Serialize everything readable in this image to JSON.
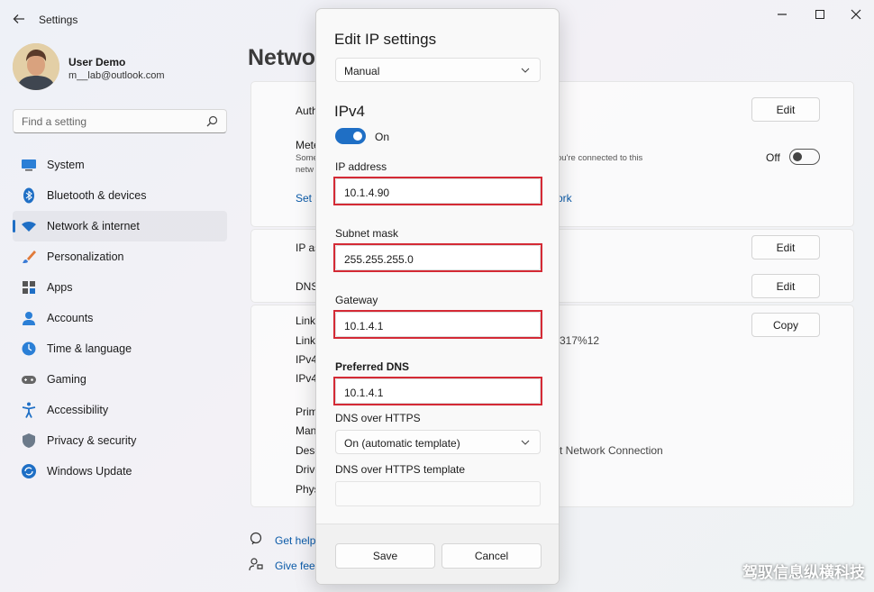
{
  "window": {
    "title": "Settings"
  },
  "user": {
    "name": "User Demo",
    "email": "m__lab@outlook.com"
  },
  "search": {
    "placeholder": "Find a setting"
  },
  "sidebar": {
    "items": [
      {
        "label": "System",
        "icon": "system-icon"
      },
      {
        "label": "Bluetooth & devices",
        "icon": "bluetooth-icon"
      },
      {
        "label": "Network & internet",
        "icon": "wifi-icon",
        "active": true
      },
      {
        "label": "Personalization",
        "icon": "brush-icon"
      },
      {
        "label": "Apps",
        "icon": "apps-icon"
      },
      {
        "label": "Accounts",
        "icon": "accounts-icon"
      },
      {
        "label": "Time & language",
        "icon": "clock-globe-icon"
      },
      {
        "label": "Gaming",
        "icon": "gamepad-icon"
      },
      {
        "label": "Accessibility",
        "icon": "accessibility-icon"
      },
      {
        "label": "Privacy & security",
        "icon": "shield-icon"
      },
      {
        "label": "Windows Update",
        "icon": "update-icon"
      }
    ]
  },
  "background": {
    "heading": "Networ",
    "rows": {
      "auth": "Auth",
      "metered": "Mete",
      "metered_desc_l": "Some",
      "metered_desc_r": "ou're connected to this",
      "metered_desc_2": "netw",
      "set_link_l": "Set a",
      "set_link_r": "ork",
      "ip_assign": "IP as",
      "dns": "DNS",
      "link1": "Link",
      "link2": "Link-",
      "link2_val": "317%12",
      "ipv4a": "IPv4",
      "ipv4b": "IPv4",
      "primary": "Prim",
      "manufacturer": "Man",
      "description": "Desc",
      "description_val": "t Network Connection",
      "driver": "Drive",
      "physical": "Phys"
    },
    "buttons": {
      "edit1": "Edit",
      "edit2": "Edit",
      "edit3": "Edit",
      "copy": "Copy"
    },
    "metered_toggle": "Off",
    "links": {
      "get_help": "Get help",
      "give_feedback": "Give feec"
    }
  },
  "dialog": {
    "title": "Edit IP settings",
    "mode": "Manual",
    "section": "IPv4",
    "toggle": "On",
    "ip_label": "IP address",
    "ip_value": "10.1.4.90",
    "subnet_label": "Subnet mask",
    "subnet_value": "255.255.255.0",
    "gateway_label": "Gateway",
    "gateway_value": "10.1.4.1",
    "dns_label": "Preferred DNS",
    "dns_value": "10.1.4.1",
    "doh_label": "DNS over HTTPS",
    "doh_value": "On (automatic template)",
    "doh_template_label": "DNS over HTTPS template",
    "save": "Save",
    "cancel": "Cancel"
  },
  "watermark": "驾驭信息纵横科技",
  "colors": {
    "accent": "#1f6fc5",
    "highlight": "#d42a35",
    "link": "#0a5aa8"
  }
}
